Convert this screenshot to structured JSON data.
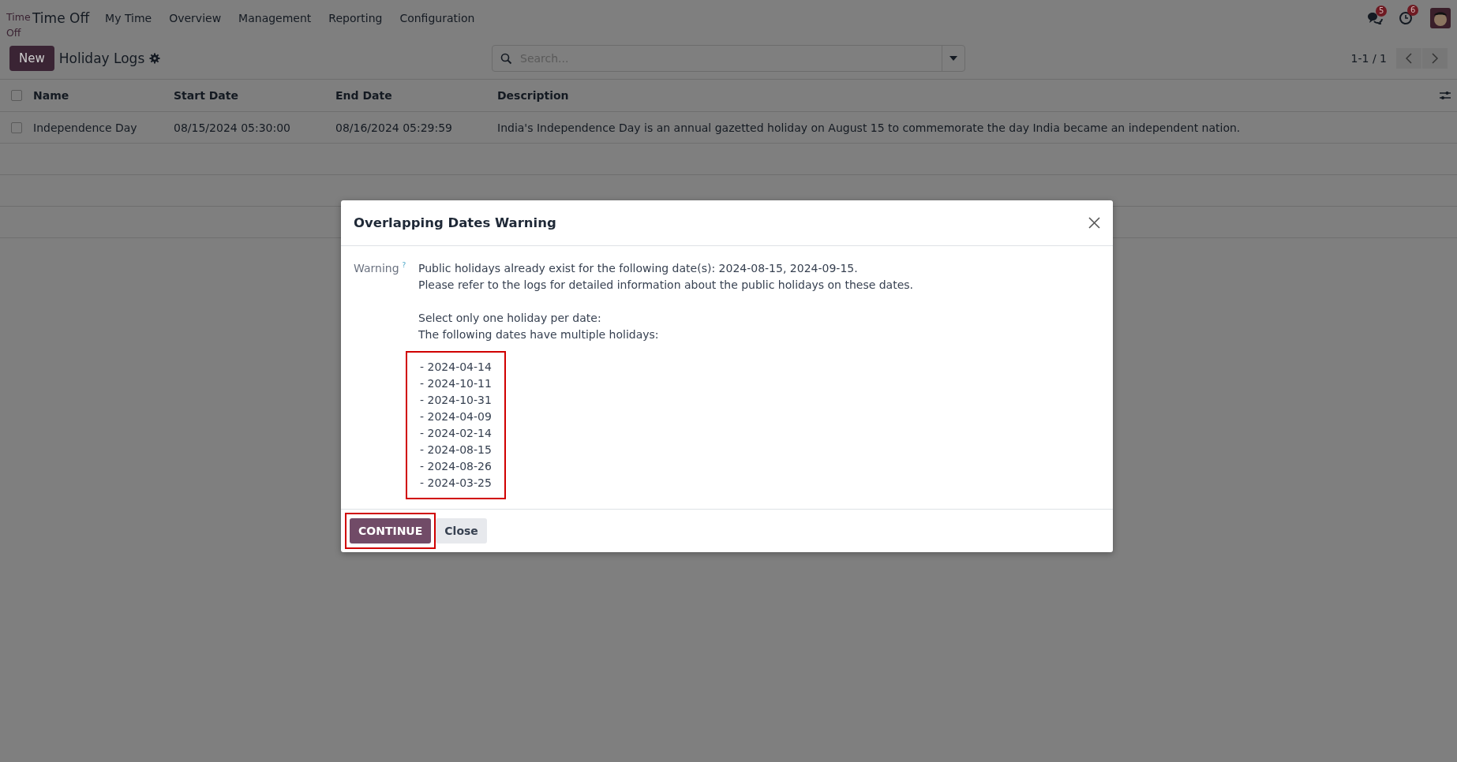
{
  "navbar": {
    "logo_alt": "Time Off",
    "app_name": "Time Off",
    "menu": [
      "My Time",
      "Overview",
      "Management",
      "Reporting",
      "Configuration"
    ],
    "messages_badge": "5",
    "activities_badge": "6"
  },
  "control_panel": {
    "new_button": "New",
    "title": "Holiday Logs",
    "search": {
      "placeholder": "Search..."
    },
    "pager": "1-1 / 1"
  },
  "table": {
    "all_selected": false,
    "columns": [
      "Name",
      "Start Date",
      "End Date",
      "Description"
    ],
    "rows": [
      {
        "selected": false,
        "cells": [
          "Independence Day",
          "08/15/2024 05:30:00",
          "08/16/2024 05:29:59",
          "India's Independence Day is an annual gazetted holiday on August 15 to commemorate the day India became an independent nation."
        ]
      }
    ]
  },
  "dialog": {
    "title": "Overlapping Dates Warning",
    "field_label": "Warning",
    "help_mark": "?",
    "lines": [
      "Public holidays already exist for the following date(s): 2024-08-15, 2024-09-15.",
      "Please refer to the logs for detailed information about the public holidays on these dates."
    ],
    "lines_2": [
      "Select only one holiday per date:",
      "The following dates have multiple holidays:"
    ],
    "dates_highlighted": true,
    "dates": [
      "- 2024-04-14",
      "- 2024-10-11",
      "- 2024-10-31",
      "- 2024-04-09",
      "- 2024-02-14",
      "- 2024-08-15",
      "- 2024-08-26",
      "- 2024-03-25"
    ],
    "buttons": [
      {
        "label": "CONTINUE",
        "kind": "primary",
        "highlighted": true
      },
      {
        "label": "Close",
        "kind": "secondary",
        "highlighted": false
      }
    ]
  }
}
